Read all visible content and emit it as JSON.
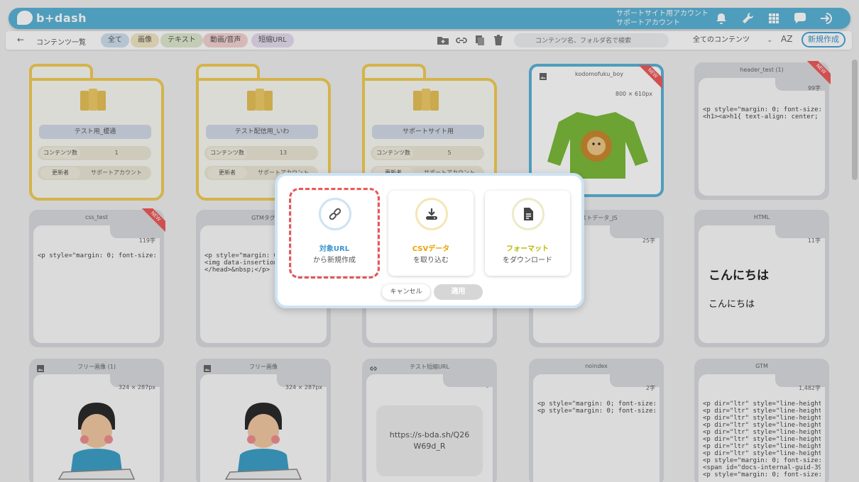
{
  "app": {
    "logo_text": "b+dash"
  },
  "header": {
    "account_line1": "サポートサイト用アカウント",
    "account_line2": "サポートアカウント",
    "icons": [
      "bell-icon",
      "wrench-icon",
      "grid-icon",
      "chat-icon",
      "logout-icon"
    ]
  },
  "toolbar": {
    "breadcrumb": "コンテンツ一覧",
    "filters": [
      {
        "label": "全て",
        "color": "#cfe0ee"
      },
      {
        "label": "画像",
        "color": "#f2e6c4"
      },
      {
        "label": "テキスト",
        "color": "#dfeacf"
      },
      {
        "label": "動画/音声",
        "color": "#f5d2d2"
      },
      {
        "label": "短縮URL",
        "color": "#e5dcee"
      }
    ],
    "search_placeholder": "コンテンツ名、フォルダ名で検索",
    "sort_select": "全てのコンテンツ",
    "sort_az": "AZ",
    "new_button": "新規作成"
  },
  "folders": [
    {
      "name": "テスト用_榎通",
      "count_label": "コンテンツ数",
      "count": "1",
      "updater_label": "更新者",
      "updater": "サポートアカウント"
    },
    {
      "name": "テスト配信用_いわ",
      "count_label": "コンテンツ数",
      "count": "13",
      "updater_label": "更新者",
      "updater": "サポートアカウント"
    },
    {
      "name": "サポートサイト用",
      "count_label": "コンテンツ数",
      "count": "5",
      "updater_label": "更新者",
      "updater": "サポートアカウント"
    }
  ],
  "cards": {
    "image_new": {
      "title": "kodomofuku_boy",
      "meta": "800 × 610px",
      "tag": "NEW"
    },
    "header_test": {
      "title": "header_test (1)",
      "meta": "99字",
      "tag": "NEW",
      "code": "<p style=\"margin: 0; font-size: 18\n<h1><a>h1{ text-align: center; fo"
    },
    "css_test": {
      "title": "css_test",
      "meta": "119字",
      "tag": "NEW",
      "code": "<p style=\"margin: 0; font-size: 18"
    },
    "gtm_tag": {
      "title": "GTMタグ",
      "code": "<p style=\"margin: 0\n<img data-insertion\n</head>&nbsp;</p>"
    },
    "test_js": {
      "title": "テストデータ_JS",
      "meta": "25字"
    },
    "html": {
      "title": "HTML",
      "meta": "11字",
      "heading": "こんにちは",
      "paragraph": "こんにちは"
    },
    "free_image_1": {
      "title": "フリー画像 (1)",
      "meta": "324 × 287px"
    },
    "free_image": {
      "title": "フリー画像",
      "meta": "324 × 287px"
    },
    "short_url": {
      "title": "テスト短縮URL",
      "meta": "-",
      "url": "https://s-bda.sh/Q26W69d_R"
    },
    "noindex": {
      "title": "noindex",
      "meta": "2字",
      "code": "<p style=\"margin: 0; font-size: 18\n<p style=\"margin: 0; font-size: 18"
    },
    "gtm": {
      "title": "GTM",
      "meta": "1,482字",
      "code": "<p dir=\"ltr\" style=\"line-height: 1\n<p dir=\"ltr\" style=\"line-height: 1\n<p dir=\"ltr\" style=\"line-height: 1\n<p dir=\"ltr\" style=\"line-height: 1\n<p dir=\"ltr\" style=\"line-height: 1\n<p dir=\"ltr\" style=\"line-height: 1\n<p dir=\"ltr\" style=\"line-height: 1\n<p dir=\"ltr\" style=\"line-height: 1\n<p style=\"margin: 0; font-size: 18\n<span id=\"docs-internal-guid-390\n<p style=\"margin: 0; font-size: 18"
    }
  },
  "modal": {
    "options": [
      {
        "line1": "対象URL",
        "line2": "から新規作成",
        "color": "#3d95cc",
        "icon": "link-icon"
      },
      {
        "line1": "CSVデータ",
        "line2": "を取り込む",
        "color": "#e8a400",
        "icon": "download-icon"
      },
      {
        "line1": "フォーマット",
        "line2": "をダウンロード",
        "color": "#b8b800",
        "icon": "document-icon"
      }
    ],
    "cancel": "キャンセル",
    "apply": "適用"
  }
}
